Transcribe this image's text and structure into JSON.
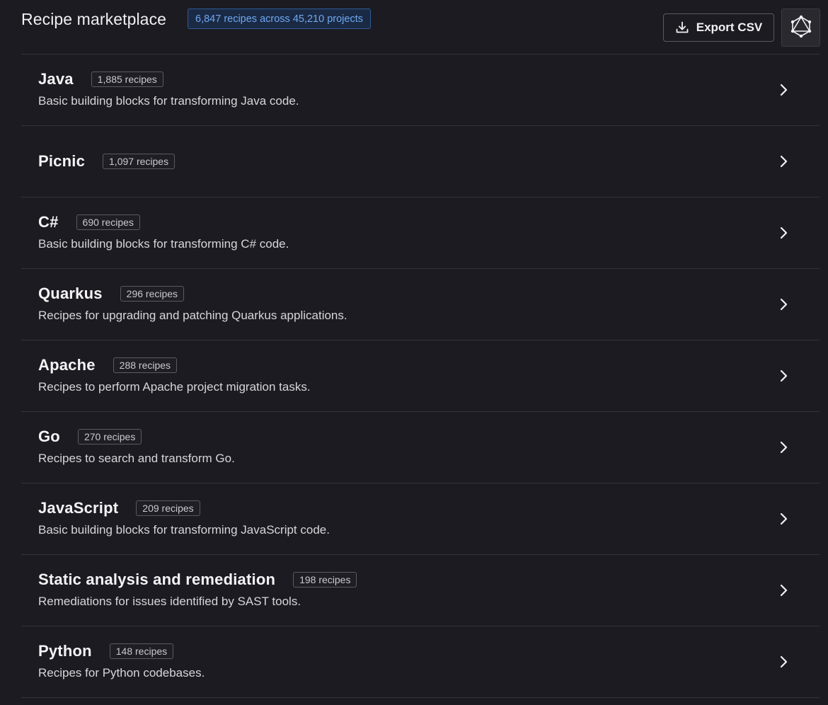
{
  "header": {
    "title": "Recipe marketplace",
    "summary_badge": "6,847 recipes across 45,210 projects",
    "export_label": "Export CSV",
    "export_icon": "download-icon",
    "graphql_icon": "graphql-icon"
  },
  "categories": [
    {
      "name": "Java",
      "count": "1,885 recipes",
      "description": "Basic building blocks for transforming Java code."
    },
    {
      "name": "Picnic",
      "count": "1,097 recipes",
      "description": ""
    },
    {
      "name": "C#",
      "count": "690 recipes",
      "description": "Basic building blocks for transforming C# code."
    },
    {
      "name": "Quarkus",
      "count": "296 recipes",
      "description": "Recipes for upgrading and patching Quarkus applications."
    },
    {
      "name": "Apache",
      "count": "288 recipes",
      "description": "Recipes to perform Apache project migration tasks."
    },
    {
      "name": "Go",
      "count": "270 recipes",
      "description": "Recipes to search and transform Go."
    },
    {
      "name": "JavaScript",
      "count": "209 recipes",
      "description": "Basic building blocks for transforming JavaScript code."
    },
    {
      "name": "Static analysis and remediation",
      "count": "198 recipes",
      "description": "Remediations for issues identified by SAST tools."
    },
    {
      "name": "Python",
      "count": "148 recipes",
      "description": "Recipes for Python codebases."
    }
  ],
  "colors": {
    "background": "#1c1b21",
    "accent": "#6ea8f2",
    "divider": "#34333b"
  }
}
